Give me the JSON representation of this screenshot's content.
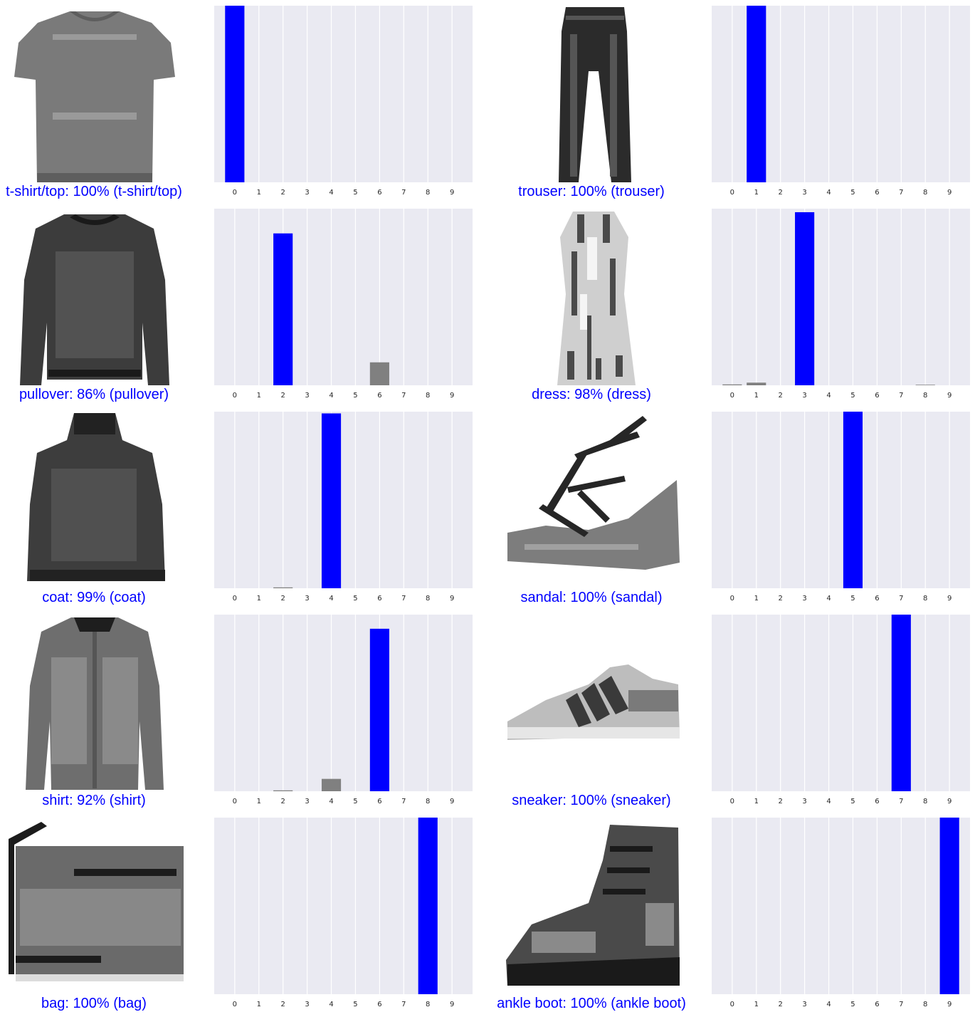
{
  "colors": {
    "correct": "#0000ff",
    "other_bars": "#808080",
    "plot_background": "#eaeaf2",
    "gridline": "#ffffff",
    "tick_text": "#262626"
  },
  "chart_data": [
    {
      "type": "bar",
      "image": "t-shirt-image",
      "caption": "t-shirt/top: 100% (t-shirt/top)",
      "categories": [
        "0",
        "1",
        "2",
        "3",
        "4",
        "5",
        "6",
        "7",
        "8",
        "9"
      ],
      "values": [
        1.0,
        0,
        0,
        0,
        0,
        0,
        0,
        0,
        0,
        0
      ],
      "highlight_index": 0,
      "ylim": [
        0,
        1
      ],
      "grid": true
    },
    {
      "type": "bar",
      "image": "trouser-image",
      "caption": "trouser: 100% (trouser)",
      "categories": [
        "0",
        "1",
        "2",
        "3",
        "4",
        "5",
        "6",
        "7",
        "8",
        "9"
      ],
      "values": [
        0,
        1.0,
        0,
        0,
        0,
        0,
        0,
        0,
        0,
        0
      ],
      "highlight_index": 1,
      "ylim": [
        0,
        1
      ],
      "grid": true
    },
    {
      "type": "bar",
      "image": "pullover-image",
      "caption": "pullover: 86% (pullover)",
      "categories": [
        "0",
        "1",
        "2",
        "3",
        "4",
        "5",
        "6",
        "7",
        "8",
        "9"
      ],
      "values": [
        0,
        0,
        0.86,
        0,
        0,
        0,
        0.13,
        0,
        0,
        0
      ],
      "highlight_index": 2,
      "ylim": [
        0,
        1
      ],
      "grid": true
    },
    {
      "type": "bar",
      "image": "dress-image",
      "caption": "dress: 98% (dress)",
      "categories": [
        "0",
        "1",
        "2",
        "3",
        "4",
        "5",
        "6",
        "7",
        "8",
        "9"
      ],
      "values": [
        0.005,
        0.015,
        0,
        0.98,
        0,
        0,
        0,
        0,
        0.003,
        0
      ],
      "highlight_index": 3,
      "ylim": [
        0,
        1
      ],
      "grid": true
    },
    {
      "type": "bar",
      "image": "coat-image",
      "caption": "coat: 99% (coat)",
      "categories": [
        "0",
        "1",
        "2",
        "3",
        "4",
        "5",
        "6",
        "7",
        "8",
        "9"
      ],
      "values": [
        0,
        0,
        0.005,
        0,
        0.99,
        0,
        0,
        0,
        0,
        0
      ],
      "highlight_index": 4,
      "ylim": [
        0,
        1
      ],
      "grid": true
    },
    {
      "type": "bar",
      "image": "sandal-image",
      "caption": "sandal: 100% (sandal)",
      "categories": [
        "0",
        "1",
        "2",
        "3",
        "4",
        "5",
        "6",
        "7",
        "8",
        "9"
      ],
      "values": [
        0,
        0,
        0,
        0,
        0,
        1.0,
        0,
        0,
        0,
        0
      ],
      "highlight_index": 5,
      "ylim": [
        0,
        1
      ],
      "grid": true
    },
    {
      "type": "bar",
      "image": "shirt-image",
      "caption": "shirt: 92% (shirt)",
      "categories": [
        "0",
        "1",
        "2",
        "3",
        "4",
        "5",
        "6",
        "7",
        "8",
        "9"
      ],
      "values": [
        0,
        0,
        0.005,
        0,
        0.07,
        0,
        0.92,
        0,
        0,
        0
      ],
      "highlight_index": 6,
      "ylim": [
        0,
        1
      ],
      "grid": true
    },
    {
      "type": "bar",
      "image": "sneaker-image",
      "caption": "sneaker: 100% (sneaker)",
      "categories": [
        "0",
        "1",
        "2",
        "3",
        "4",
        "5",
        "6",
        "7",
        "8",
        "9"
      ],
      "values": [
        0,
        0,
        0,
        0,
        0,
        0,
        0,
        1.0,
        0,
        0
      ],
      "highlight_index": 7,
      "ylim": [
        0,
        1
      ],
      "grid": true
    },
    {
      "type": "bar",
      "image": "bag-image",
      "caption": "bag: 100% (bag)",
      "categories": [
        "0",
        "1",
        "2",
        "3",
        "4",
        "5",
        "6",
        "7",
        "8",
        "9"
      ],
      "values": [
        0,
        0,
        0,
        0,
        0,
        0,
        0,
        0,
        1.0,
        0
      ],
      "highlight_index": 8,
      "ylim": [
        0,
        1
      ],
      "grid": true
    },
    {
      "type": "bar",
      "image": "ankle-boot-image",
      "caption": "ankle boot: 100% (ankle boot)",
      "categories": [
        "0",
        "1",
        "2",
        "3",
        "4",
        "5",
        "6",
        "7",
        "8",
        "9"
      ],
      "values": [
        0,
        0,
        0,
        0,
        0,
        0,
        0,
        0,
        0,
        1.0
      ],
      "highlight_index": 9,
      "ylim": [
        0,
        1
      ],
      "grid": true
    }
  ]
}
